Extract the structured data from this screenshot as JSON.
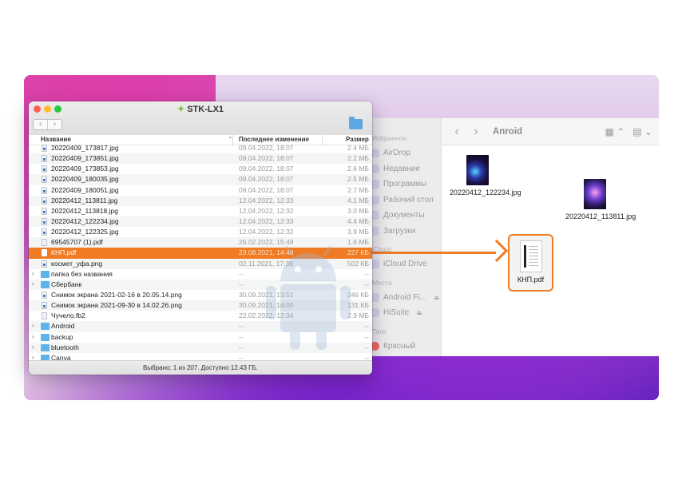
{
  "window": {
    "title": "STK-LX1",
    "columns": {
      "name": "Название",
      "modified": "Последнее изменение",
      "size": "Размер"
    },
    "status": "Выбрано: 1 из 207. Доступно 12.43 ГБ.",
    "rows": [
      {
        "name": "20220409_173817.jpg",
        "date": "09.04.2022, 18:07",
        "size": "2.4 МБ",
        "kind": "img"
      },
      {
        "name": "20220409_173851.jpg",
        "date": "09.04.2022, 18:07",
        "size": "2.2 МБ",
        "kind": "img"
      },
      {
        "name": "20220409_173853.jpg",
        "date": "09.04.2022, 18:07",
        "size": "2.6 МБ",
        "kind": "img"
      },
      {
        "name": "20220409_180035.jpg",
        "date": "09.04.2022, 18:07",
        "size": "2.5 МБ",
        "kind": "img"
      },
      {
        "name": "20220409_180051.jpg",
        "date": "09.04.2022, 18:07",
        "size": "2.7 МБ",
        "kind": "img"
      },
      {
        "name": "20220412_113811.jpg",
        "date": "12.04.2022, 12:33",
        "size": "4.1 МБ",
        "kind": "img"
      },
      {
        "name": "20220412_113818.jpg",
        "date": "12.04.2022, 12:32",
        "size": "3.0 МБ",
        "kind": "img"
      },
      {
        "name": "20220412_122234.jpg",
        "date": "12.04.2022, 12:33",
        "size": "4.4 МБ",
        "kind": "img"
      },
      {
        "name": "20220412_122325.jpg",
        "date": "12.04.2022, 12:32",
        "size": "3.9 МБ",
        "kind": "img"
      },
      {
        "name": "69545707 (1).pdf",
        "date": "26.02.2022, 15:49",
        "size": "1.6 МБ",
        "kind": "file"
      },
      {
        "name": "КНП.pdf",
        "date": "23.08.2021, 14:48",
        "size": "227 КБ",
        "kind": "file",
        "selected": true
      },
      {
        "name": "космет_уфа.png",
        "date": "02.11.2021, 17:39",
        "size": "502 КБ",
        "kind": "img"
      },
      {
        "name": "папка без названия",
        "date": "--",
        "size": "--",
        "kind": "folder"
      },
      {
        "name": "Сбербанк",
        "date": "--",
        "size": "--",
        "kind": "folder"
      },
      {
        "name": "Снимок экрана 2021-02-16 в 20.05.14.png",
        "date": "30.09.2021, 13:51",
        "size": "246 КБ",
        "kind": "img"
      },
      {
        "name": "Снимок экрана 2021-09-30 в 14.02.26.png",
        "date": "30.09.2021, 14:00",
        "size": "131 КБ",
        "kind": "img"
      },
      {
        "name": "Чучело.fb2",
        "date": "22.02.2022, 12:34",
        "size": "2.9 МБ",
        "kind": "file"
      },
      {
        "name": "Android",
        "date": "--",
        "size": "--",
        "kind": "folder"
      },
      {
        "name": "backup",
        "date": "--",
        "size": "--",
        "kind": "folder"
      },
      {
        "name": "bluetooth",
        "date": "--",
        "size": "--",
        "kind": "folder"
      },
      {
        "name": "Canva",
        "date": "--",
        "size": "--",
        "kind": "folder"
      }
    ]
  },
  "finder": {
    "title": "Anroid",
    "sidebar": {
      "favorites_header": "Избранное",
      "items": [
        "AirDrop",
        "Недавние",
        "Программы",
        "Рабочий стол",
        "Документы",
        "Загрузки"
      ],
      "icloud_header": "iCloud",
      "icloud_items": [
        "iCloud Drive"
      ],
      "locations_header": "Места",
      "location_items": [
        "Android Fi...",
        "HiSuite"
      ],
      "tags_header": "Теги",
      "tag_items": [
        "Красный"
      ]
    },
    "files": [
      {
        "name": "20220412_122234.jpg"
      },
      {
        "name": "20220412_113811.jpg"
      },
      {
        "name": "КНП.pdf"
      }
    ]
  },
  "colors": {
    "accent": "#ef7b24",
    "android_green": "#7cc242"
  }
}
